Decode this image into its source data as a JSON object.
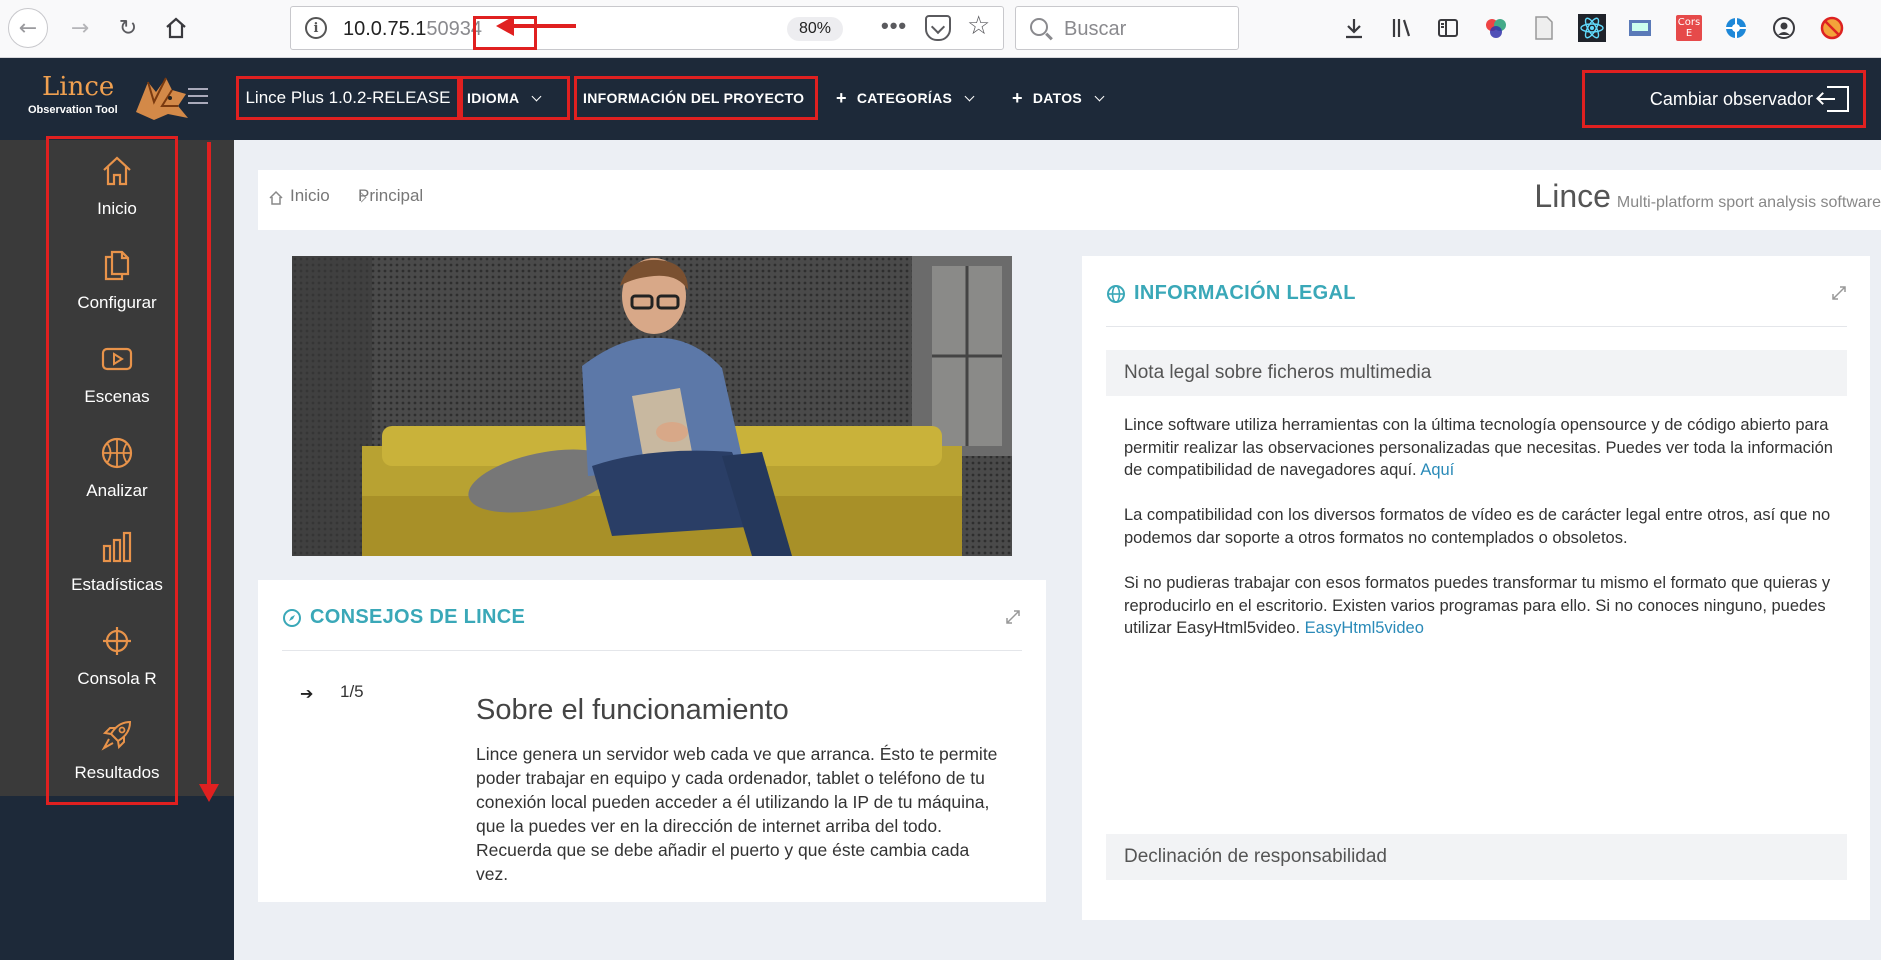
{
  "browser": {
    "url_host": "10.0.75.1",
    "url_port": "50934",
    "zoom": "80%",
    "search_placeholder": "Buscar",
    "cors_line1": "Cors",
    "cors_line2": "E"
  },
  "header": {
    "logo_title": "Lince",
    "logo_subtitle": "Observation Tool",
    "version": "Lince Plus 1.0.2-RELEASE",
    "menu": {
      "language": "IDIOMA",
      "project_info": "INFORMACIÓN DEL PROYECTO",
      "categories": "CATEGORÍAS",
      "data": "DATOS"
    },
    "change_observer": "Cambiar observador"
  },
  "sidebar": {
    "items": [
      {
        "label": "Inicio",
        "icon": "home-icon"
      },
      {
        "label": "Configurar",
        "icon": "files-icon"
      },
      {
        "label": "Escenas",
        "icon": "video-icon"
      },
      {
        "label": "Analizar",
        "icon": "basketball-icon"
      },
      {
        "label": "Estadísticas",
        "icon": "bar-chart-icon"
      },
      {
        "label": "Consola R",
        "icon": "crosshair-icon"
      },
      {
        "label": "Resultados",
        "icon": "rocket-icon"
      }
    ]
  },
  "breadcrumb": {
    "home": "Inicio",
    "current": "Principal",
    "title": "Lince",
    "subtitle": "Multi-platform sport analysis software"
  },
  "tips": {
    "title": "CONSEJOS DE LINCE",
    "counter": "1/5",
    "heading": "Sobre el funcionamiento",
    "body": "Lince genera un servidor web cada ve que arranca. Ésto te permite poder trabajar en equipo y cada ordenador, tablet o teléfono de tu conexión local pueden acceder a él utilizando la IP de tu máquina, que la puedes ver en la dirección de internet arriba del todo. Recuerda que se debe añadir el puerto y que éste cambia cada vez."
  },
  "legal": {
    "title": "INFORMACIÓN LEGAL",
    "section1_title": "Nota legal sobre ficheros multimedia",
    "p1": "Lince software utiliza herramientas con la última tecnología opensource y de código abierto para permitir realizar las observaciones personalizadas que necesitas. Puedes ver toda la información de compatibilidad de navegadores aquí.",
    "p1_link": "Aquí",
    "p2": "La compatibilidad con los diversos formatos de vídeo es de carácter legal entre otros, así que no podemos dar soporte a otros formatos no contemplados o obsoletos.",
    "p3": "Si no pudieras trabajar con esos formatos puedes transformar tu mismo el formato que quieras y reproducirlo en el escritorio. Existen varios programas para ello. Si no conoces ninguno, puedes utilizar EasyHtml5video.",
    "p3_link": "EasyHtml5video",
    "section2_title": "Declinación de responsabilidad"
  },
  "colors": {
    "header_bg": "#1d2939",
    "sidebar_bg": "#3a3a3a",
    "accent": "#3aa8b8",
    "icon_orange": "#e8934a",
    "annotation_red": "#e02020"
  }
}
